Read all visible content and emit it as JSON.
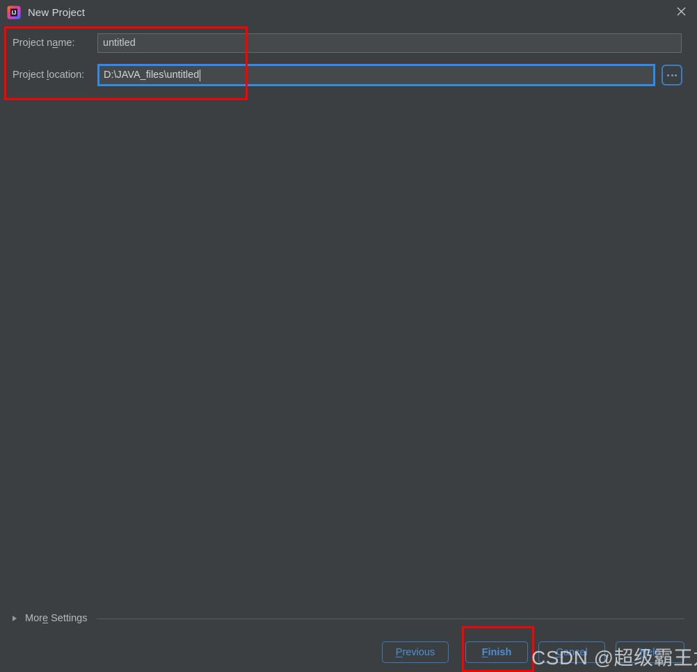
{
  "window": {
    "title": "New Project",
    "app_icon": "intellij-idea-icon",
    "close_icon": "close-icon",
    "background_color": "#3c3f41"
  },
  "form": {
    "project_name": {
      "label_before": "Project n",
      "label_mnemonic": "a",
      "label_after": "me:",
      "value": "untitled",
      "placeholder": ""
    },
    "project_location": {
      "label_before": "Project ",
      "label_mnemonic": "l",
      "label_after": "ocation:",
      "value": "D:\\JAVA_files\\untitled",
      "placeholder": "",
      "focused": true,
      "focus_color": "#2f8ae8",
      "browse_button_label": "...",
      "browse_icon": "ellipsis-icon"
    }
  },
  "more_settings": {
    "label_before": "Mor",
    "label_mnemonic": "e",
    "label_after": " Settings",
    "expanded": false,
    "toggle_icon": "chevron-right-icon"
  },
  "buttons": {
    "previous": {
      "before": "",
      "mnemonic": "P",
      "after": "revious"
    },
    "finish": {
      "before": "",
      "mnemonic": "F",
      "after": "inish",
      "default": true
    },
    "cancel": {
      "before": "",
      "mnemonic": "C",
      "after": "ancel"
    },
    "help": {
      "before": "",
      "mnemonic": "H",
      "after": "elp"
    },
    "accent_color": "#4a90d9"
  },
  "annotations": {
    "color": "#fe0000",
    "boxes": [
      {
        "name": "fields-highlight"
      },
      {
        "name": "finish-highlight"
      }
    ]
  },
  "watermark": {
    "text": "CSDN @超级霸王龙战士"
  }
}
